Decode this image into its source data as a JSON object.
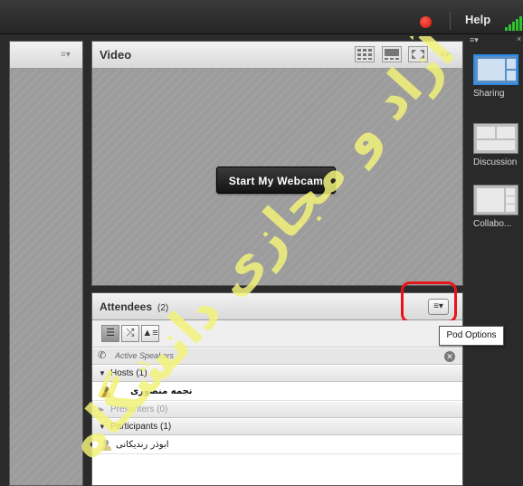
{
  "topbar": {
    "help_label": "Help"
  },
  "video_pod": {
    "title": "Video",
    "webcam_button": "Start My Webcam"
  },
  "attendees_pod": {
    "title": "Attendees",
    "count": "(2)",
    "active_speakers": "Active Speakers",
    "hosts_header": "Hosts (1)",
    "presenters_header": "Presenters (0)",
    "participants_header": "Participants (1)",
    "hosts": [
      "نجمه منصوری"
    ],
    "participants": [
      "ابوذر رندیکانی"
    ]
  },
  "tooltip": {
    "pod_options": "Pod Options"
  },
  "layouts": [
    "Sharing",
    "Discussion",
    "Collabo..."
  ],
  "watermark": {
    "text": "آزاد و مجازی دانشگاه"
  },
  "colors": {
    "highlight_ring": "#e8141b",
    "selected_layout": "#2a8be6",
    "watermark": "#f2f27a"
  }
}
